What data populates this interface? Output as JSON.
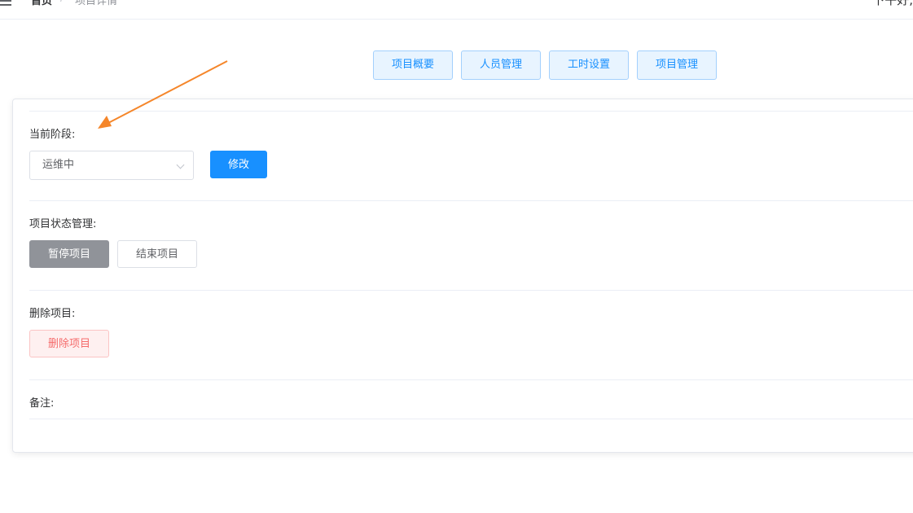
{
  "header": {
    "breadcrumb": {
      "home": "首页",
      "separator": "/",
      "current": "项目详情"
    },
    "greeting": "下午好,"
  },
  "tabs": [
    {
      "label": "项目概要"
    },
    {
      "label": "人员管理"
    },
    {
      "label": "工时设置"
    },
    {
      "label": "项目管理"
    }
  ],
  "stage": {
    "label": "当前阶段:",
    "selected": "运维中",
    "modify_button": "修改"
  },
  "status": {
    "label": "项目状态管理:",
    "pause_button": "暂停项目",
    "end_button": "结束项目"
  },
  "delete": {
    "label": "删除项目:",
    "delete_button": "删除项目"
  },
  "remark": {
    "label": "备注:"
  },
  "colors": {
    "primary": "#1890ff",
    "info": "#909399",
    "danger": "#f56c6c",
    "annotation_arrow": "#f5862a"
  }
}
